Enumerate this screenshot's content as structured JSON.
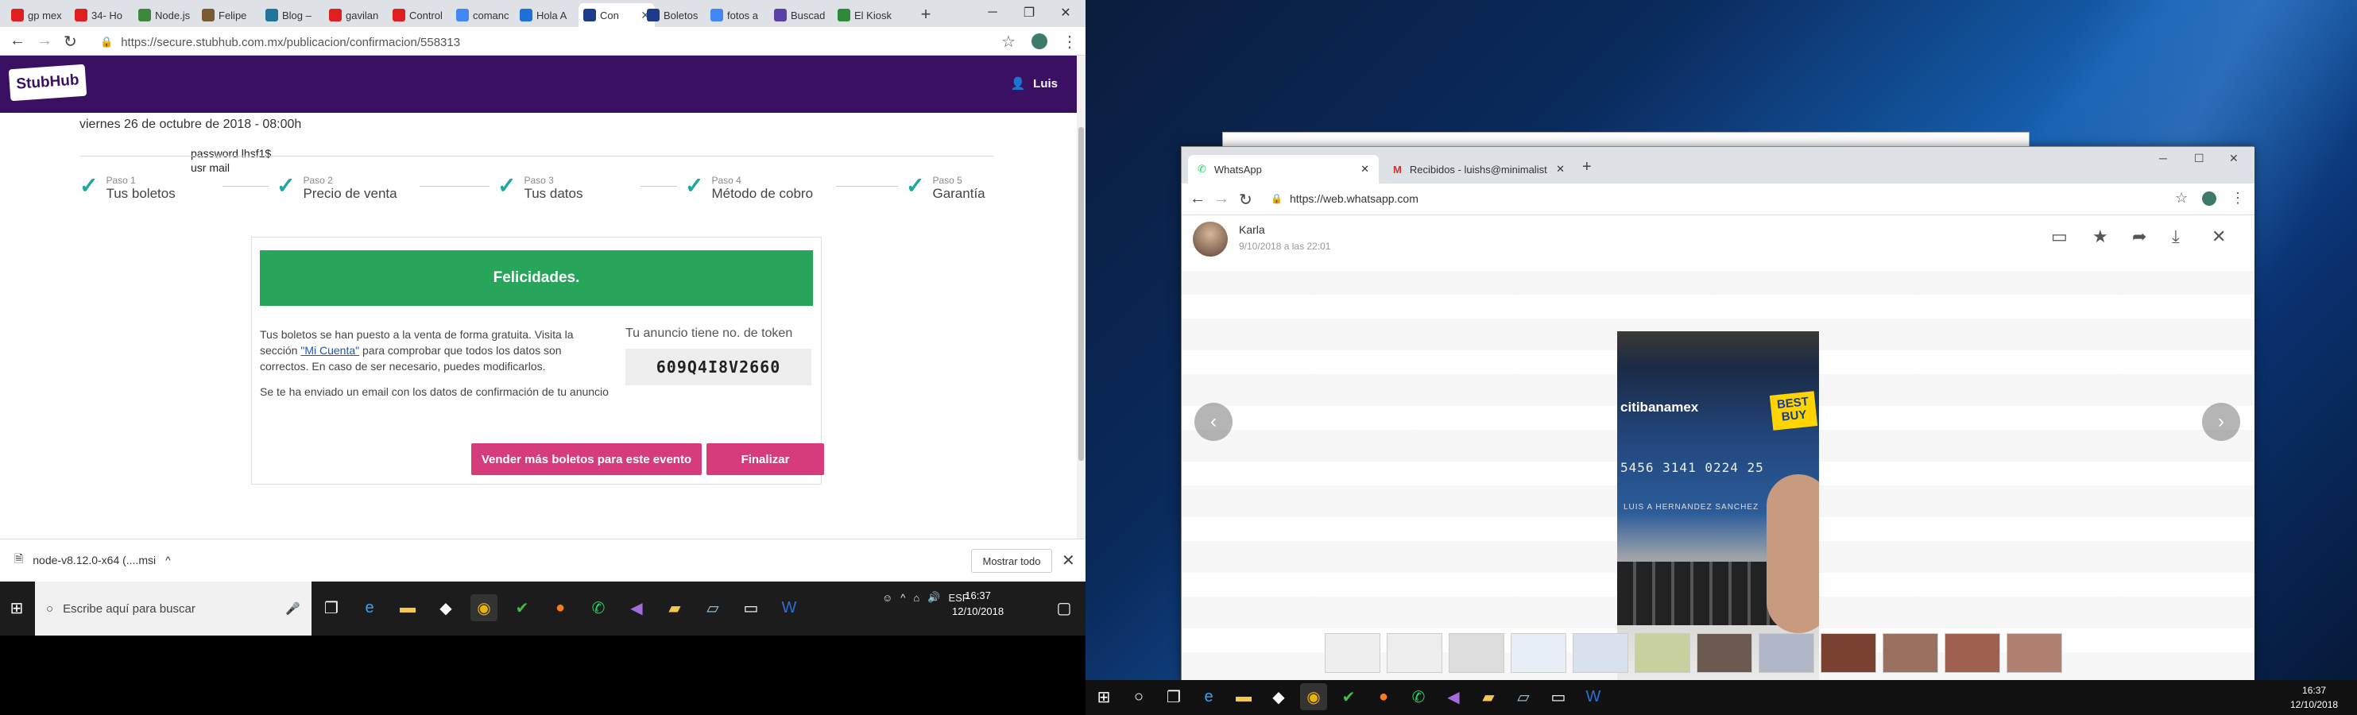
{
  "left_browser": {
    "tabs": [
      {
        "label": "gp mex",
        "color": "#e02020"
      },
      {
        "label": "34- Ho",
        "color": "#e02020"
      },
      {
        "label": "Node.js",
        "color": "#3c873a"
      },
      {
        "label": "Felipe",
        "color": "#7a5a30"
      },
      {
        "label": "Blog –",
        "color": "#21759b"
      },
      {
        "label": "gavilan",
        "color": "#e02020"
      },
      {
        "label": "Control",
        "color": "#e02020"
      },
      {
        "label": "comanc",
        "color": "#4285f4"
      },
      {
        "label": "Hola A",
        "color": "#1e6fd9"
      },
      {
        "label": "Con",
        "color": "#1e3a8a"
      },
      {
        "label": "Boletos",
        "color": "#1e3a8a"
      },
      {
        "label": "fotos a",
        "color": "#4285f4"
      },
      {
        "label": "Buscad",
        "color": "#5b3fa8"
      },
      {
        "label": "El Kiosk",
        "color": "#2c8a3a"
      }
    ],
    "url": "https://secure.stubhub.com.mx/publicacion/confirmacion/558313",
    "logo": "StubHub",
    "user": "Luis",
    "event_date": "viernes 26 de octubre de 2018 - 08:00h",
    "password_note": "password  lhsf1$",
    "user_note": "usr mail",
    "steps": [
      {
        "label": "Paso 1",
        "title": "Tus boletos"
      },
      {
        "label": "Paso 2",
        "title": "Precio de venta"
      },
      {
        "label": "Paso 3",
        "title": "Tus datos"
      },
      {
        "label": "Paso 4",
        "title": "Método de cobro"
      },
      {
        "label": "Paso 5",
        "title": "Garantía"
      }
    ],
    "congrats": "Felicidades.",
    "msg_part1": "Tus boletos se han puesto a la venta de forma gratuita. Visita la sección ",
    "msg_link": "\"Mi Cuenta\"",
    "msg_part2": " para comprobar que todos los datos son correctos. En caso de ser necesario, puedes modificarlos.",
    "msg_email": "Se te ha enviado un email con los datos de confirmación de tu anuncio",
    "token_label": "Tu anuncio tiene no. de token",
    "token_value": "609Q4I8V2660",
    "btn_more": "Vender más boletos para este evento",
    "btn_finish": "Finalizar",
    "download_file": "node-v8.12.0-x64 (....msi",
    "show_all": "Mostrar todo"
  },
  "left_taskbar": {
    "search_placeholder": "Escribe aquí para buscar",
    "lang": "ESP",
    "time": "16:37",
    "date": "12/10/2018"
  },
  "right_browser": {
    "tab_whatsapp": "WhatsApp",
    "tab_gmail": "Recibidos - luishs@minimalist.m",
    "url": "https://web.whatsapp.com",
    "contact": "Karla",
    "msg_date": "9/10/2018 a las 22:01",
    "card_bank": "citibanamex",
    "card_brand": "BEST BUY",
    "card_number": "5456 3141 0224 25",
    "card_holder": "LUIS A HERNANDEZ SANCHEZ"
  },
  "right_taskbar": {
    "time": "16:37",
    "date": "12/10/2018"
  }
}
